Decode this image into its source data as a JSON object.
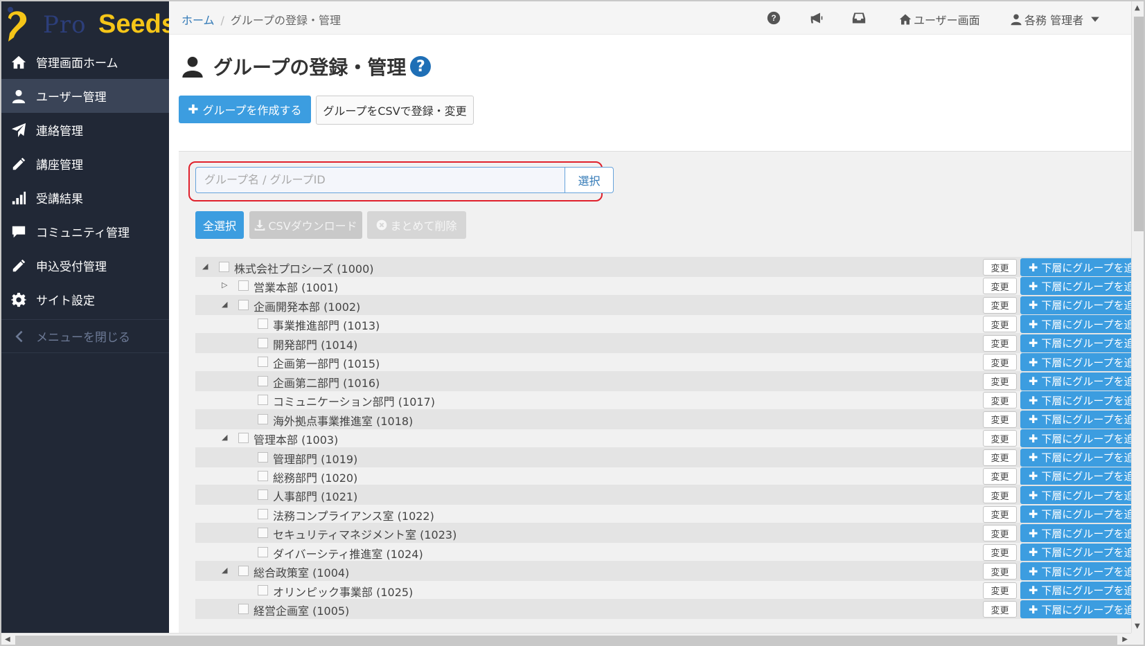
{
  "logo": {
    "pro_text": "Pro",
    "seeds_text": "Seeds"
  },
  "sidebar": {
    "items": [
      {
        "label": "管理画面ホーム",
        "icon": "home-icon",
        "active": false
      },
      {
        "label": "ユーザー管理",
        "icon": "user-icon",
        "active": true
      },
      {
        "label": "連絡管理",
        "icon": "paper-plane-icon",
        "active": false
      },
      {
        "label": "講座管理",
        "icon": "pencil-icon",
        "active": false
      },
      {
        "label": "受講結果",
        "icon": "bar-chart-icon",
        "active": false
      },
      {
        "label": "コミュニティ管理",
        "icon": "comment-icon",
        "active": false
      },
      {
        "label": "申込受付管理",
        "icon": "pencil-icon",
        "active": false
      },
      {
        "label": "サイト設定",
        "icon": "gear-icon",
        "active": false
      }
    ],
    "close_menu_label": "メニューを閉じる"
  },
  "header": {
    "breadcrumb": {
      "home": "ホーム",
      "separator": "/",
      "current": "グループの登録・管理"
    },
    "icons": [
      "help-icon",
      "megaphone-icon",
      "inbox-icon"
    ],
    "user_screen_label": "ユーザー画面",
    "account_label": "各務 管理者"
  },
  "page": {
    "title": "グループの登録・管理",
    "help_mark": "?",
    "create_button": "グループを作成する",
    "csv_register_button": "グループをCSVで登録・変更"
  },
  "search": {
    "placeholder": "グループ名 / グループID",
    "select_button": "選択"
  },
  "toolbar": {
    "select_all": "全選択",
    "csv_download": "CSVダウンロード",
    "bulk_delete": "まとめて削除"
  },
  "tree": {
    "edit_label": "変更",
    "add_child_label": "下層にグループを追加",
    "rows": [
      {
        "label": "株式会社プロシーズ (1000)",
        "level": 0,
        "toggle": "expanded"
      },
      {
        "label": "営業本部 (1001)",
        "level": 1,
        "toggle": "collapsed"
      },
      {
        "label": "企画開発本部 (1002)",
        "level": 1,
        "toggle": "expanded"
      },
      {
        "label": "事業推進部門 (1013)",
        "level": 2,
        "toggle": "none"
      },
      {
        "label": "開発部門 (1014)",
        "level": 2,
        "toggle": "none"
      },
      {
        "label": "企画第一部門 (1015)",
        "level": 2,
        "toggle": "none"
      },
      {
        "label": "企画第二部門 (1016)",
        "level": 2,
        "toggle": "none"
      },
      {
        "label": "コミュニケーション部門 (1017)",
        "level": 2,
        "toggle": "none"
      },
      {
        "label": "海外拠点事業推進室 (1018)",
        "level": 2,
        "toggle": "none"
      },
      {
        "label": "管理本部 (1003)",
        "level": 1,
        "toggle": "expanded"
      },
      {
        "label": "管理部門 (1019)",
        "level": 2,
        "toggle": "none"
      },
      {
        "label": "総務部門 (1020)",
        "level": 2,
        "toggle": "none"
      },
      {
        "label": "人事部門 (1021)",
        "level": 2,
        "toggle": "none"
      },
      {
        "label": "法務コンプライアンス室 (1022)",
        "level": 2,
        "toggle": "none"
      },
      {
        "label": "セキュリティマネジメント室 (1023)",
        "level": 2,
        "toggle": "none"
      },
      {
        "label": "ダイバーシティ推進室 (1024)",
        "level": 2,
        "toggle": "none"
      },
      {
        "label": "総合政策室 (1004)",
        "level": 1,
        "toggle": "expanded"
      },
      {
        "label": "オリンピック事業部 (1025)",
        "level": 2,
        "toggle": "none"
      },
      {
        "label": "経営企画室 (1005)",
        "level": 1,
        "toggle": "none"
      }
    ]
  },
  "colors": {
    "sidebar_bg": "#212836",
    "sidebar_active": "#3a4457",
    "primary": "#3c9de0",
    "highlight_border": "#e0202b",
    "logo_yellow": "#f5c518"
  }
}
